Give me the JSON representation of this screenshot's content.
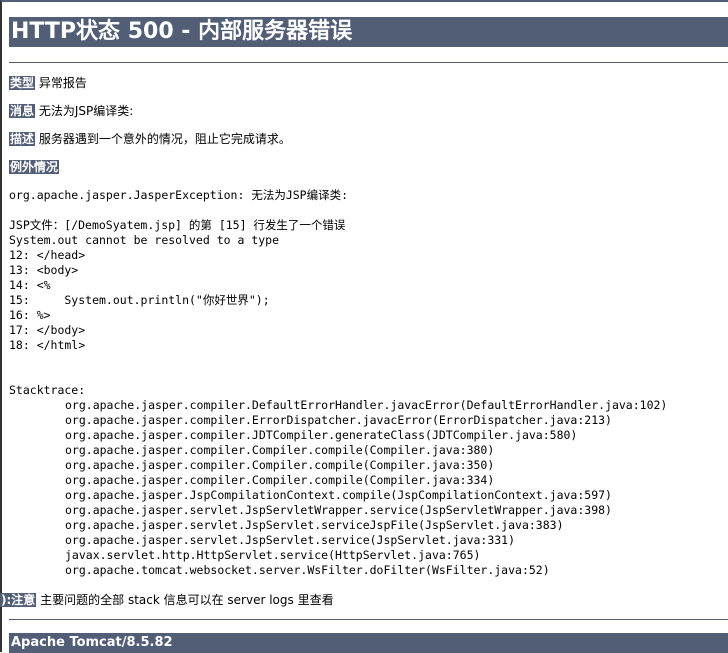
{
  "title": "HTTP状态 500 - 内部服务器错误",
  "type": {
    "label": "类型",
    "value": "异常报告"
  },
  "message": {
    "label": "消息",
    "value": "无法为JSP编译类:"
  },
  "description": {
    "label": "描述",
    "value": "服务器遇到一个意外的情况，阻止它完成请求。"
  },
  "exception": {
    "label": "例外情况"
  },
  "exception_lines": [
    "org.apache.jasper.JasperException: 无法为JSP编译类:",
    "",
    "JSP文件：[/DemoSyatem.jsp] 的第 [15] 行发生了一个错误",
    "System.out cannot be resolved to a type",
    "12: </head>",
    "13: <body>",
    "14: <%",
    "15:     System.out.println(\"你好世界\");",
    "16: %>",
    "17: </body>",
    "18: </html>",
    "",
    "",
    "Stacktrace:"
  ],
  "stacktrace": [
    "org.apache.jasper.compiler.DefaultErrorHandler.javacError(DefaultErrorHandler.java:102)",
    "org.apache.jasper.compiler.ErrorDispatcher.javacError(ErrorDispatcher.java:213)",
    "org.apache.jasper.compiler.JDTCompiler.generateClass(JDTCompiler.java:580)",
    "org.apache.jasper.compiler.Compiler.compile(Compiler.java:380)",
    "org.apache.jasper.compiler.Compiler.compile(Compiler.java:350)",
    "org.apache.jasper.compiler.Compiler.compile(Compiler.java:334)",
    "org.apache.jasper.JspCompilationContext.compile(JspCompilationContext.java:597)",
    "org.apache.jasper.servlet.JspServletWrapper.service(JspServletWrapper.java:398)",
    "org.apache.jasper.servlet.JspServlet.serviceJspFile(JspServlet.java:383)",
    "org.apache.jasper.servlet.JspServlet.service(JspServlet.java:331)",
    "javax.servlet.http.HttpServlet.service(HttpServlet.java:765)",
    "org.apache.tomcat.websocket.server.WsFilter.doFilter(WsFilter.java:52)"
  ],
  "note": {
    "label": "):注意",
    "value": "主要问题的全部 stack 信息可以在 server logs 里查看"
  },
  "footer": "Apache Tomcat/8.5.82"
}
